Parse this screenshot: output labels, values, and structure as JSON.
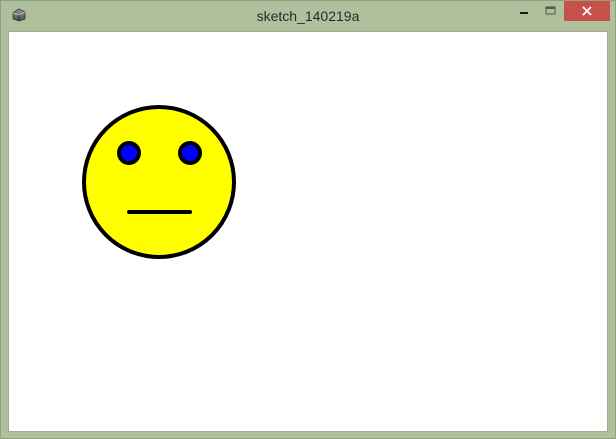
{
  "window": {
    "title": "sketch_140219a",
    "frame_color": "#afc09d",
    "close_color": "#c7504a"
  },
  "icons": {
    "app": "processing-app-icon",
    "minimize": "minimize-icon",
    "maximize": "maximize-icon",
    "close": "close-icon"
  },
  "sketch": {
    "face_fill": "#ffff00",
    "eye_fill": "#0000ff",
    "outline": "#000000",
    "expression": "neutral"
  }
}
